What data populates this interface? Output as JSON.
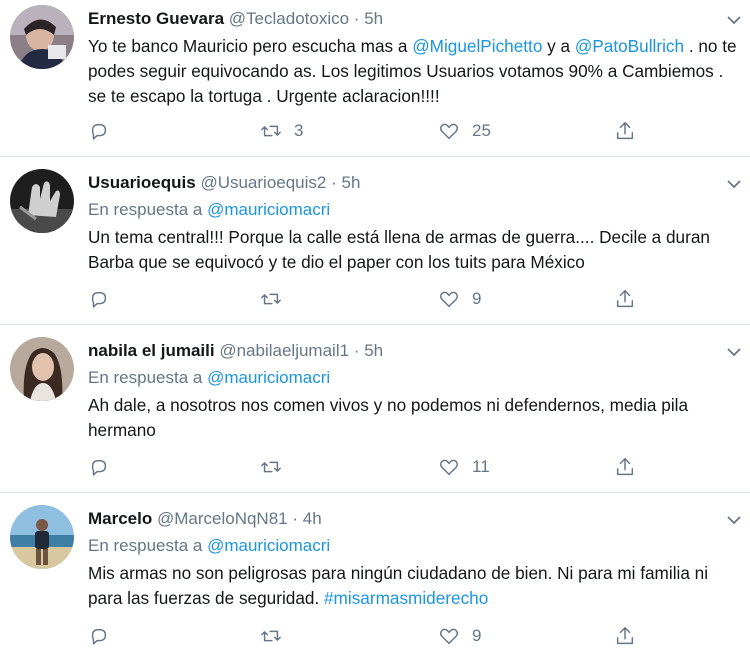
{
  "tweets": [
    {
      "name": "Ernesto Guevara",
      "handle": "@Tecladotoxico",
      "separator": "·",
      "time": "5h",
      "reply_prefix": "",
      "reply_to": "",
      "text_segments": [
        {
          "t": "Yo te banco Mauricio pero escucha mas a ",
          "link": false
        },
        {
          "t": "@MiguelPichetto",
          "link": true
        },
        {
          "t": " y a ",
          "link": false
        },
        {
          "t": "@PatoBullrich",
          "link": true
        },
        {
          "t": " . no te podes seguir equivocando as. Los legitimos Usuarios votamos 90% a Cambiemos . se te escapo la tortuga . Urgente aclaracion!!!!",
          "link": false
        }
      ],
      "replies": "",
      "retweets": "3",
      "likes": "25"
    },
    {
      "name": "Usuarioequis",
      "handle": "@Usuarioequis2",
      "separator": "·",
      "time": "5h",
      "reply_prefix": "En respuesta a",
      "reply_to": "@mauriciomacri",
      "text_segments": [
        {
          "t": "Un tema central!!! Porque la calle está llena de armas de guerra.... Decile a duran Barba que se equivocó y te dio el paper con los tuits para México",
          "link": false
        }
      ],
      "replies": "",
      "retweets": "",
      "likes": "9"
    },
    {
      "name": "nabila el jumaili",
      "handle": "@nabilaeljumail1",
      "separator": "·",
      "time": "5h",
      "reply_prefix": "En respuesta a",
      "reply_to": "@mauriciomacri",
      "text_segments": [
        {
          "t": "Ah dale, a nosotros nos comen vivos y no podemos ni defendernos, media pila hermano",
          "link": false
        }
      ],
      "replies": "",
      "retweets": "",
      "likes": "11"
    },
    {
      "name": "Marcelo",
      "handle": "@MarceloNqN81",
      "separator": "·",
      "time": "4h",
      "reply_prefix": "En respuesta a",
      "reply_to": "@mauriciomacri",
      "text_segments": [
        {
          "t": "Mis armas no son peligrosas para ningún ciudadano de bien. Ni para mi familia ni para las fuerzas de seguridad. ",
          "link": false
        },
        {
          "t": "#misarmasmiderecho",
          "link": true
        }
      ],
      "replies": "",
      "retweets": "",
      "likes": "9"
    }
  ],
  "colors": {
    "link": "#1b95e0",
    "muted": "#657786",
    "text": "#14171a",
    "divider": "#e1e8ed"
  },
  "icons": {
    "reply": "reply-icon",
    "retweet": "retweet-icon",
    "like": "heart-icon",
    "share": "share-icon",
    "more": "chevron-down-icon"
  }
}
